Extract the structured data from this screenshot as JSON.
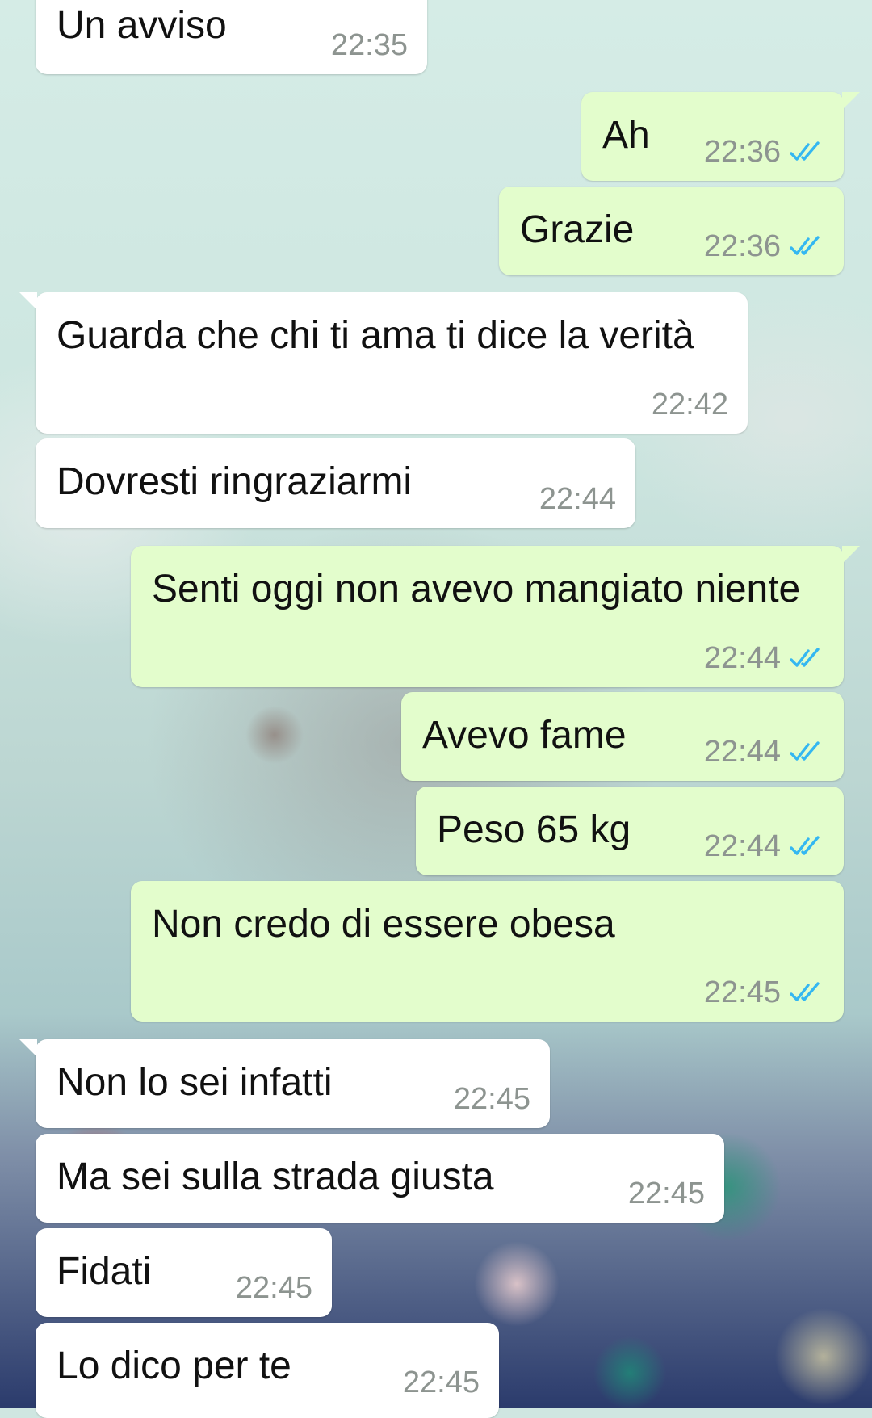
{
  "conversation": {
    "colors": {
      "incoming_bubble": "#ffffff",
      "outgoing_bubble": "#e3fdcc",
      "timestamp": "#8d9490",
      "read_ticks": "#34b7f1"
    },
    "messages": [
      {
        "direction": "incoming",
        "text": "Un avviso",
        "time": "22:35"
      },
      {
        "direction": "outgoing",
        "text": "Ah",
        "time": "22:36",
        "status": "read"
      },
      {
        "direction": "outgoing",
        "text": "Grazie",
        "time": "22:36",
        "status": "read"
      },
      {
        "direction": "incoming",
        "text": "Guarda che chi ti ama ti dice la verità",
        "time": "22:42"
      },
      {
        "direction": "incoming",
        "text": "Dovresti ringraziarmi",
        "time": "22:44"
      },
      {
        "direction": "outgoing",
        "text": "Senti oggi non avevo mangiato niente",
        "time": "22:44",
        "status": "read"
      },
      {
        "direction": "outgoing",
        "text": "Avevo fame",
        "time": "22:44",
        "status": "read"
      },
      {
        "direction": "outgoing",
        "text": "Peso 65 kg",
        "time": "22:44",
        "status": "read"
      },
      {
        "direction": "outgoing",
        "text": "Non credo di essere obesa",
        "time": "22:45",
        "status": "read"
      },
      {
        "direction": "incoming",
        "text": "Non lo sei infatti",
        "time": "22:45"
      },
      {
        "direction": "incoming",
        "text": "Ma sei sulla strada giusta",
        "time": "22:45"
      },
      {
        "direction": "incoming",
        "text": "Fidati",
        "time": "22:45"
      },
      {
        "direction": "incoming",
        "text": "Lo dico per te",
        "time": "22:45"
      }
    ]
  }
}
